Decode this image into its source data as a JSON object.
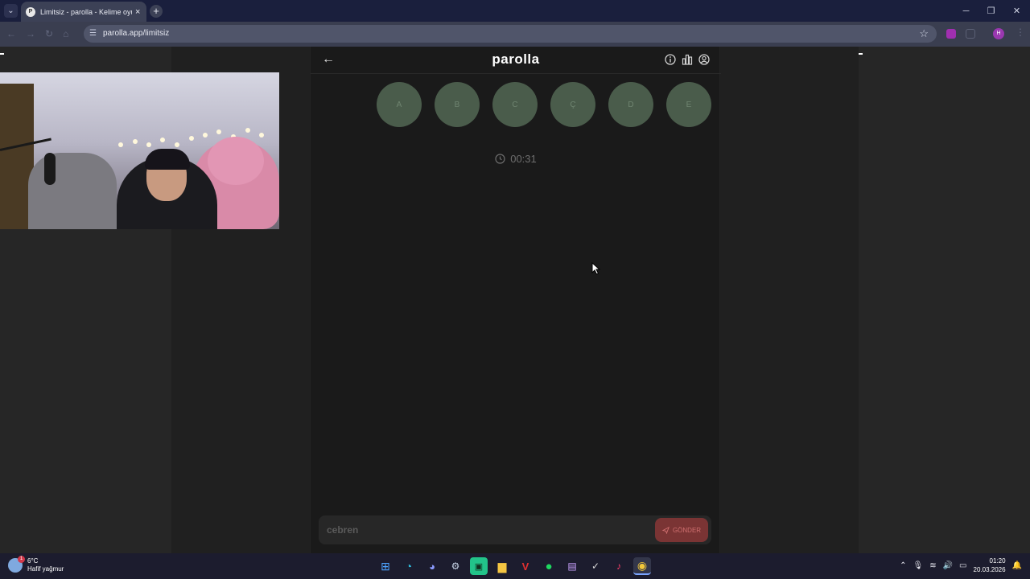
{
  "browser": {
    "tab_title": "Limitsiz - parolla - Kelime oyunu",
    "url": "parolla.app/limitsiz",
    "profile_initial": "H"
  },
  "game": {
    "logo": "parolla",
    "letters": [
      "A",
      "B",
      "C",
      "Ç",
      "D",
      "E"
    ],
    "timer": "00:31",
    "input_value": "cebren",
    "send_label": "GÖNDER"
  },
  "taskbar": {
    "weather_temp": "6°C",
    "weather_desc": "Hafif yağmur",
    "weather_badge": "1",
    "time": "01:20",
    "date": "20.03.2026"
  },
  "colors": {
    "letter_circle": "#4a5c4b",
    "send_button": "#7a3434",
    "tabbar": "#1a1f3d"
  }
}
